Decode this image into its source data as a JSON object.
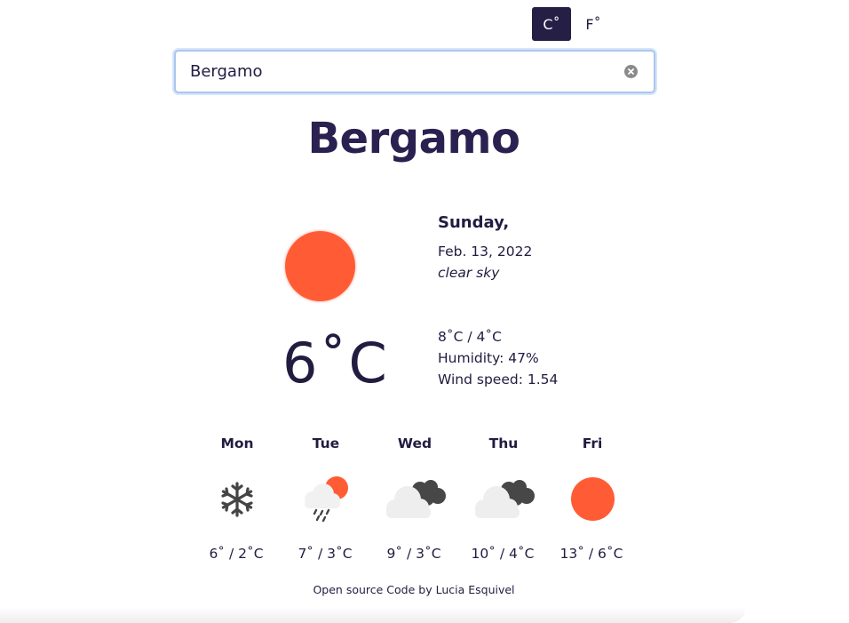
{
  "units": {
    "celsius": "C˚",
    "fahrenheit": "F˚",
    "active": "celsius"
  },
  "search": {
    "value": "Bergamo",
    "placeholder": ""
  },
  "current": {
    "city": "Bergamo",
    "day": "Sunday,",
    "date": "Feb. 13, 2022",
    "description": "clear sky",
    "temperature": "6˚C",
    "range": "8˚C / 4˚C",
    "humidity": "Humidity: 47%",
    "wind": "Wind speed: 1.54",
    "icon": "sun-icon"
  },
  "forecast": [
    {
      "day": "Mon",
      "temps": "6˚ / 2˚C",
      "icon": "snowflake-icon"
    },
    {
      "day": "Tue",
      "temps": "7˚ / 3˚C",
      "icon": "rain-sun-cloud-icon"
    },
    {
      "day": "Wed",
      "temps": "9˚ / 3˚C",
      "icon": "broken-clouds-icon"
    },
    {
      "day": "Thu",
      "temps": "10˚ / 4˚C",
      "icon": "broken-clouds-icon"
    },
    {
      "day": "Fri",
      "temps": "13˚ / 6˚C",
      "icon": "sun-icon"
    }
  ],
  "footer": {
    "text": "Open source Code by Lucia Esquivel"
  },
  "colors": {
    "accent": "#251f45",
    "sun": "#ff5c36",
    "text": "#221c40",
    "focus": "#a9c6ef"
  }
}
